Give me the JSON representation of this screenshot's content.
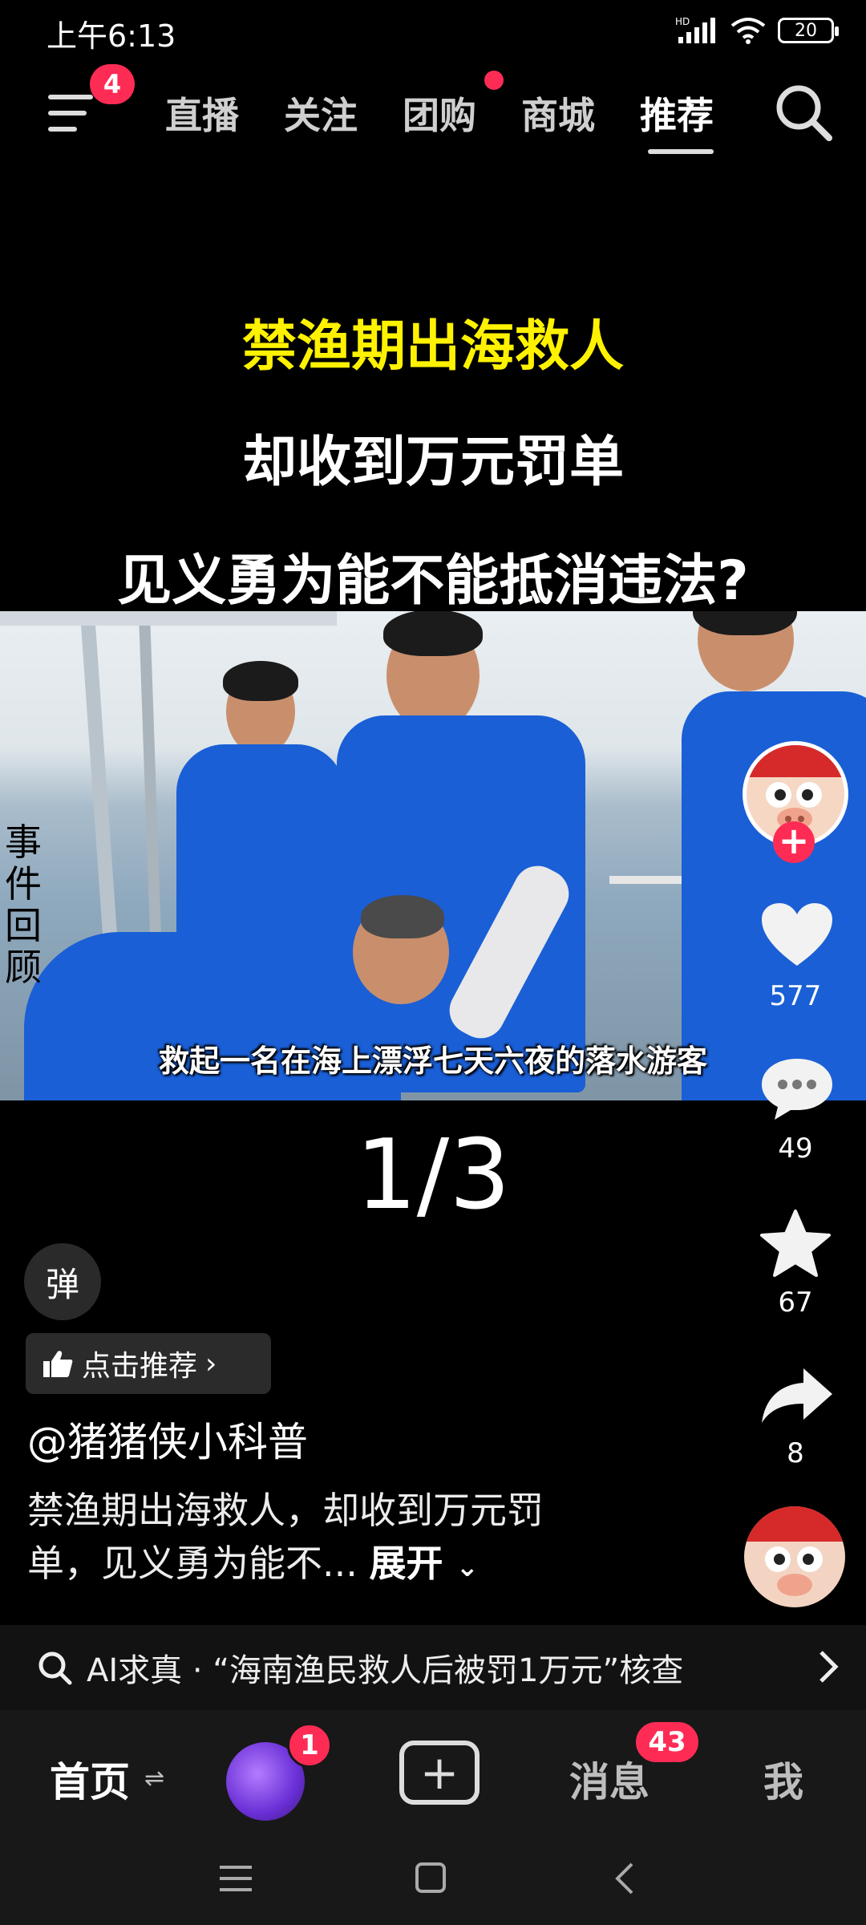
{
  "status_bar": {
    "time": "上午6:13",
    "network": "HD",
    "battery": "20"
  },
  "top_nav": {
    "menu_badge": "4",
    "tabs": [
      {
        "label": "直播"
      },
      {
        "label": "关注"
      },
      {
        "label": "团购"
      },
      {
        "label": "商城"
      },
      {
        "label": "推荐"
      }
    ],
    "active_tab": "推荐"
  },
  "video": {
    "headline_1": "禁渔期出海救人",
    "headline_2": "却收到万元罚单",
    "headline_3": "见义勇为能不能抵消违法?",
    "side_caption": "事件回顾",
    "subtitle": "救起一名在海上漂浮七天六夜的落水游客",
    "page_indicator": "1/3"
  },
  "actions": {
    "likes": "577",
    "comments": "49",
    "favorites": "67",
    "shares": "8",
    "follow": "+"
  },
  "danmaku_label": "弹",
  "recommend_label": "点击推荐",
  "author": "@猪猪侠小科普",
  "description": "禁渔期出海救人，却收到万元罚单，见义勇为能不...",
  "expand_label": "展开",
  "ai_bar": {
    "text": "AI求真 · “海南渔民救人后被罚1万元”核查"
  },
  "bottom_nav": {
    "home": "首页",
    "friends_badge": "1",
    "messages": "消息",
    "messages_badge": "43",
    "me": "我"
  },
  "colors": {
    "accent": "#fe2c55",
    "headline_yellow": "#fff200",
    "shirt_blue": "#1a5fd6"
  }
}
